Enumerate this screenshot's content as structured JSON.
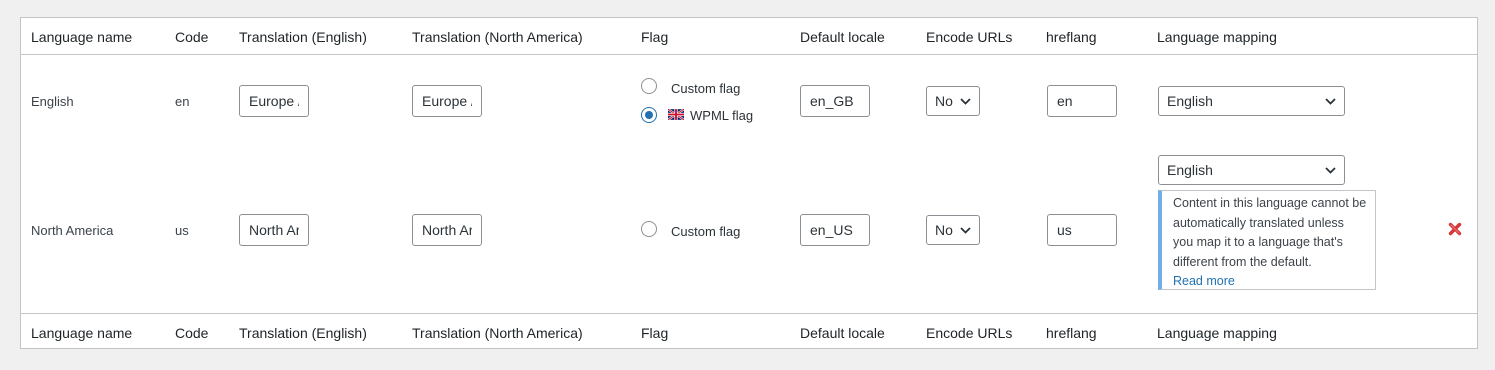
{
  "columns": [
    "Language name",
    "Code",
    "Translation (English)",
    "Translation (North America)",
    "Flag",
    "Default locale",
    "Encode URLs",
    "hreflang",
    "Language mapping"
  ],
  "rows": [
    {
      "name": "English",
      "code": "en",
      "translation_english": "Europe /",
      "translation_north_america": "Europe /",
      "flag_options": [
        {
          "label": "Custom flag",
          "selected": false
        },
        {
          "label": "WPML flag",
          "selected": true
        }
      ],
      "default_locale": "en_GB",
      "encode_urls": "No",
      "hreflang": "en",
      "language_mapping": "English"
    },
    {
      "name": "North America",
      "code": "us",
      "translation_english": "North Ar",
      "translation_north_america": "North Ar",
      "flag_options": [
        {
          "label": "Custom flag",
          "selected": false
        }
      ],
      "default_locale": "en_US",
      "encode_urls": "No",
      "hreflang": "us",
      "language_mapping": "English",
      "mapping_notice": "Content in this language cannot be automatically translated unless you map it to a language that's different from the default.",
      "mapping_notice_link": "Read more"
    }
  ],
  "colors": {
    "accent": "#2271b1",
    "notice_border": "#72aee6",
    "delete": "#d63638"
  },
  "icons": {
    "wpml_flag": "uk-flag-icon",
    "delete": "delete-icon",
    "select_arrow": "chevron-down-icon"
  }
}
